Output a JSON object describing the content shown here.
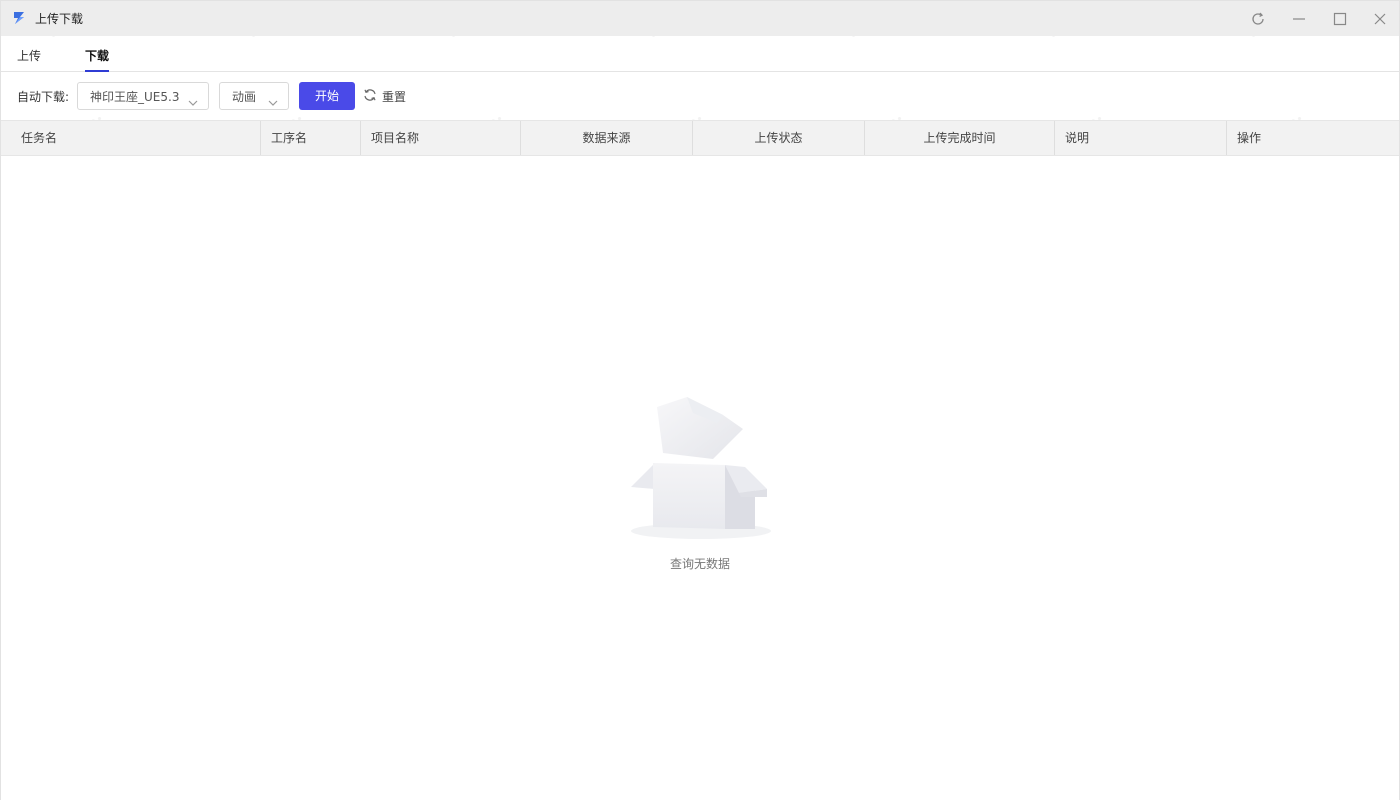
{
  "window": {
    "title": "上传下载",
    "controls": [
      "refresh-icon",
      "minimize-icon",
      "maximize-icon",
      "close-icon"
    ]
  },
  "tabs": [
    {
      "label": "上传",
      "active": false
    },
    {
      "label": "下载",
      "active": true
    }
  ],
  "toolbar": {
    "auto_download_label": "自动下载:",
    "project_select": {
      "value": "神印王座_UE5.3"
    },
    "type_select": {
      "value": "动画"
    },
    "start_button": "开始",
    "reset_button": "重置"
  },
  "table": {
    "columns": [
      "任务名",
      "工序名",
      "项目名称",
      "数据来源",
      "上传状态",
      "上传完成时间",
      "说明",
      "操作"
    ],
    "rows": []
  },
  "empty_state": {
    "text": "查询无数据",
    "icon": "empty-box-icon"
  },
  "colors": {
    "primary": "#4a4ae8",
    "tab_indicator": "#2f3cd4",
    "titlebar_bg": "#ededed",
    "header_bg": "#f2f2f2"
  }
}
